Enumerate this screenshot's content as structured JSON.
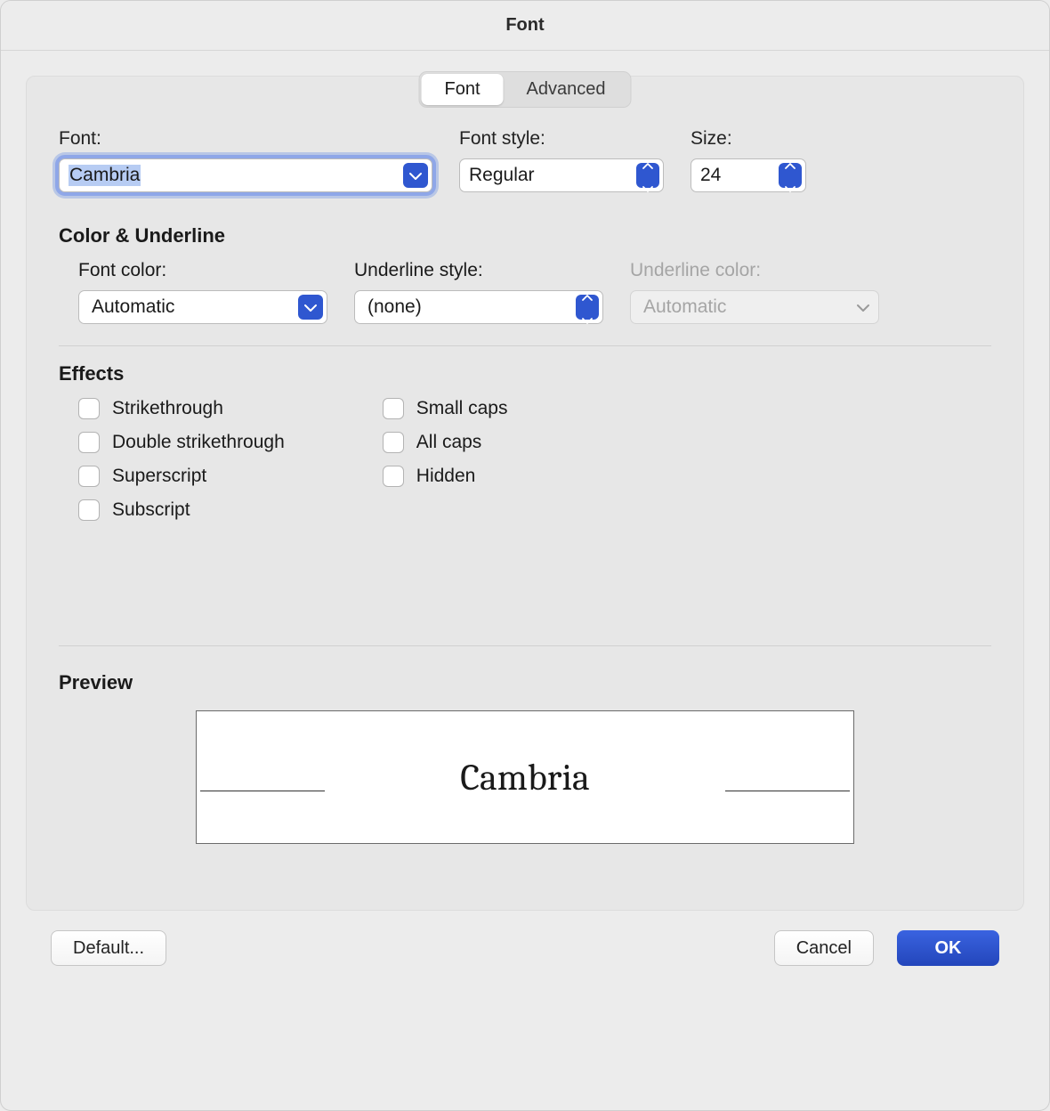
{
  "window_title": "Font",
  "tabs": {
    "font": "Font",
    "advanced": "Advanced"
  },
  "fields": {
    "font_label": "Font:",
    "font_value": "Cambria",
    "style_label": "Font style:",
    "style_value": "Regular",
    "size_label": "Size:",
    "size_value": "24"
  },
  "color_section_title": "Color & Underline",
  "color": {
    "font_color_label": "Font color:",
    "font_color_value": "Automatic",
    "underline_style_label": "Underline style:",
    "underline_style_value": "(none)",
    "underline_color_label": "Underline color:",
    "underline_color_value": "Automatic"
  },
  "effects_title": "Effects",
  "effects": {
    "strikethrough": "Strikethrough",
    "double_strike": "Double strikethrough",
    "superscript": "Superscript",
    "subscript": "Subscript",
    "small_caps": "Small caps",
    "all_caps": "All caps",
    "hidden": "Hidden"
  },
  "preview_title": "Preview",
  "preview_text": "Cambria",
  "buttons": {
    "default": "Default...",
    "cancel": "Cancel",
    "ok": "OK"
  }
}
